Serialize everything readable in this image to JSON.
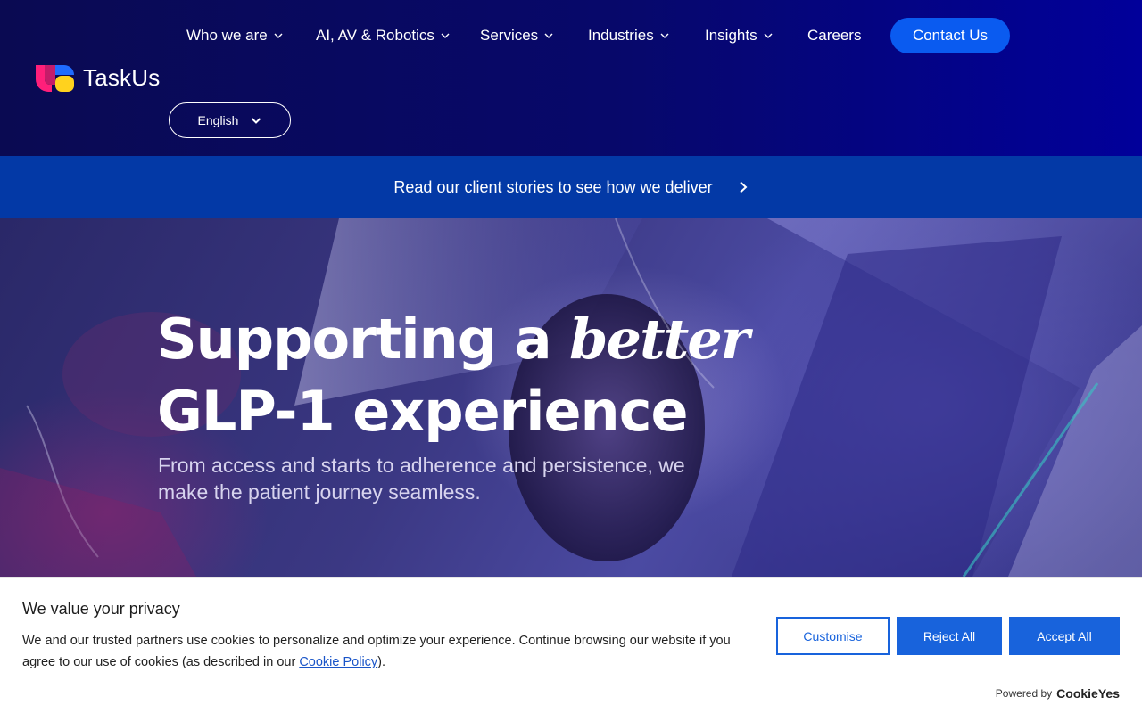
{
  "nav": {
    "items": [
      {
        "label": "Who we are",
        "has_dropdown": true
      },
      {
        "label": "AI, AV & Robotics",
        "has_dropdown": true
      },
      {
        "label": "Services",
        "has_dropdown": true
      },
      {
        "label": "Industries",
        "has_dropdown": true
      },
      {
        "label": "Insights",
        "has_dropdown": true
      },
      {
        "label": "Careers",
        "has_dropdown": false
      }
    ],
    "contact_label": "Contact Us"
  },
  "logo": {
    "text": "TaskUs"
  },
  "language": {
    "selected": "English"
  },
  "banner": {
    "text": "Read our client stories to see how we deliver"
  },
  "hero": {
    "title_part1": "Supporting a",
    "title_script": "better",
    "title_part2": "GLP-1 experience",
    "subtitle": "From access and starts to adherence and persistence, we make the patient journey seamless."
  },
  "cookie": {
    "title": "We value your privacy",
    "text_before_link": "We and our trusted partners use cookies to personalize and optimize your experience. Continue browsing our website if you agree to our use of cookies (as described in our ",
    "link_text": "Cookie Policy",
    "text_after_link": ").",
    "customise_label": "Customise",
    "reject_label": "Reject All",
    "accept_label": "Accept All",
    "powered_label": "Powered by",
    "powered_brand": "CookieYes"
  },
  "colors": {
    "header_bg": "#07086b",
    "banner_bg": "#0339a6",
    "contact_button": "#0a5bf0",
    "cookie_button": "#1863dc",
    "logo_pink": "#ff1f7a",
    "logo_yellow": "#ffd21e",
    "logo_blue": "#1f6bff"
  }
}
